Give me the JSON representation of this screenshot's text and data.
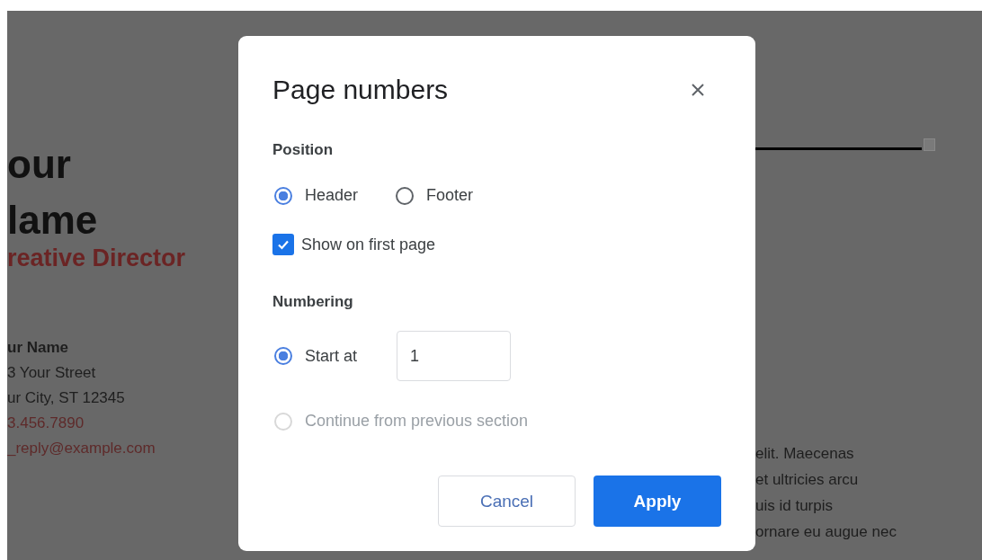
{
  "document": {
    "heading_lines": [
      "our",
      "lame"
    ],
    "subtitle": "reative Director",
    "contact": [
      {
        "kind": "name",
        "text": "ur Name"
      },
      {
        "kind": "plain",
        "text": "3 Your Street"
      },
      {
        "kind": "plain",
        "text": "ur City, ST 12345"
      },
      {
        "kind": "link",
        "text": "3.456.7890"
      },
      {
        "kind": "link",
        "text": "_reply@example.com"
      }
    ],
    "body_lines": [
      "elit. Maecenas",
      "et ultricies arcu",
      "uis id turpis",
      "ornare eu augue nec"
    ]
  },
  "dialog": {
    "title": "Page numbers",
    "position_heading": "Position",
    "position_options": [
      {
        "label": "Header",
        "selected": true
      },
      {
        "label": "Footer",
        "selected": false
      }
    ],
    "first_page": {
      "label": "Show on first page",
      "checked": true
    },
    "numbering_heading": "Numbering",
    "numbering_options": [
      {
        "kind": "start",
        "label": "Start at",
        "selected": true,
        "disabled": false,
        "value": "1"
      },
      {
        "kind": "plain",
        "label": "Continue from previous section",
        "selected": false,
        "disabled": true
      }
    ],
    "buttons": [
      {
        "kind": "secondary",
        "label": "Cancel"
      },
      {
        "kind": "primary",
        "label": "Apply"
      }
    ]
  }
}
